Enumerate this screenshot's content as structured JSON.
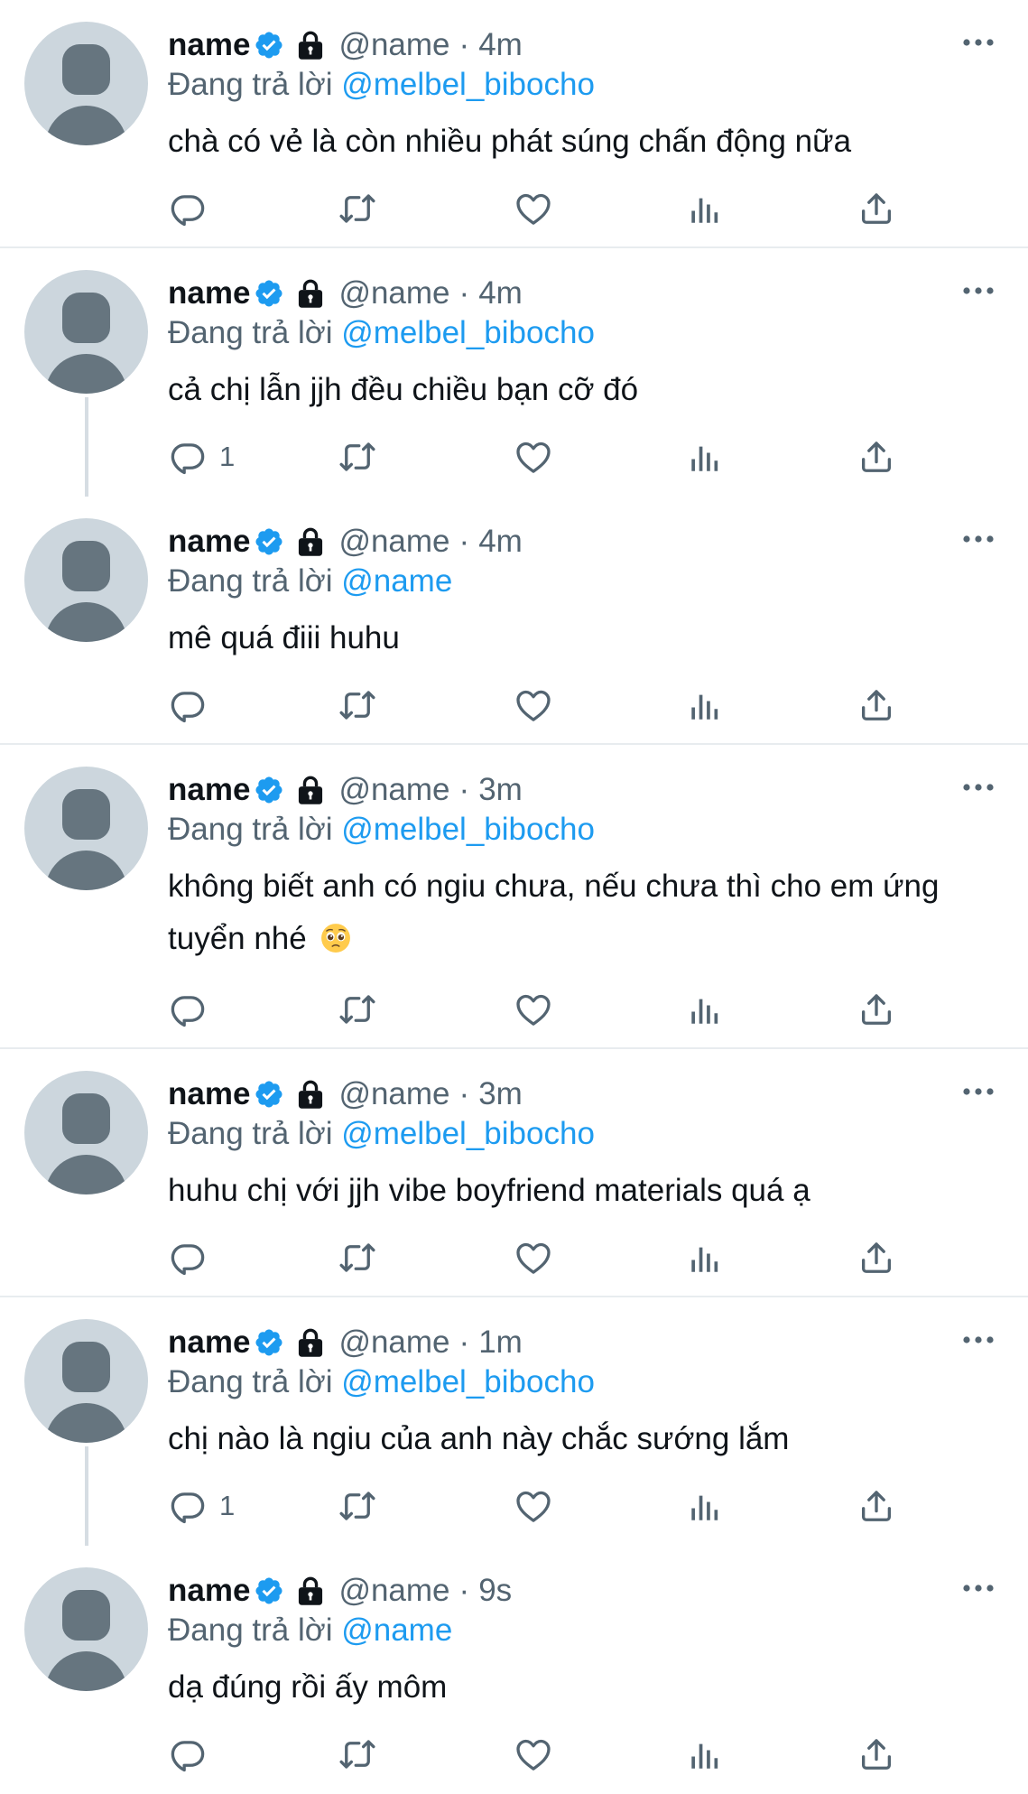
{
  "feed": {
    "tweets": [
      {
        "display_name": "name",
        "handle": "@name",
        "dot": "·",
        "time": "4m",
        "reply_prefix": "Đang trả lời",
        "reply_to": "@melbel_bibocho",
        "text": "chà có vẻ là còn nhiều phát súng chấn động nữa",
        "reply_count": "",
        "has_divider": true,
        "has_thread_line": false
      },
      {
        "display_name": "name",
        "handle": "@name",
        "dot": "·",
        "time": "4m",
        "reply_prefix": "Đang trả lời",
        "reply_to": "@melbel_bibocho",
        "text": "cả chị lẫn jjh đều chiều bạn cỡ đó",
        "reply_count": "1",
        "has_divider": false,
        "has_thread_line": true
      },
      {
        "display_name": "name",
        "handle": "@name",
        "dot": "·",
        "time": "4m",
        "reply_prefix": "Đang trả lời",
        "reply_to": "@name",
        "text": "mê quá điii huhu",
        "reply_count": "",
        "has_divider": true,
        "has_thread_line": false
      },
      {
        "display_name": "name",
        "handle": "@name",
        "dot": "·",
        "time": "3m",
        "reply_prefix": "Đang trả lời",
        "reply_to": "@melbel_bibocho",
        "text": "không biết anh có ngiu chưa, nếu chưa thì cho em ứng tuyển nhé",
        "emoji": "pleading-face-icon",
        "reply_count": "",
        "has_divider": true,
        "has_thread_line": false
      },
      {
        "display_name": "name",
        "handle": "@name",
        "dot": "·",
        "time": "3m",
        "reply_prefix": "Đang trả lời",
        "reply_to": "@melbel_bibocho",
        "text": "huhu chị với jjh vibe boyfriend materials quá ạ",
        "reply_count": "",
        "has_divider": true,
        "has_thread_line": false
      },
      {
        "display_name": "name",
        "handle": "@name",
        "dot": "·",
        "time": "1m",
        "reply_prefix": "Đang trả lời",
        "reply_to": "@melbel_bibocho",
        "text": "chị nào là ngiu của anh này chắc sướng lắm",
        "reply_count": "1",
        "has_divider": false,
        "has_thread_line": true
      },
      {
        "display_name": "name",
        "handle": "@name",
        "dot": "·",
        "time": "9s",
        "reply_prefix": "Đang trả lời",
        "reply_to": "@name",
        "text": "dạ đúng rồi ấy môm",
        "reply_count": "",
        "has_divider": false,
        "has_thread_line": false
      }
    ]
  },
  "colors": {
    "text_primary": "#0f1419",
    "text_secondary": "#536471",
    "link": "#1d9bf0",
    "verified": "#1d9bf0",
    "avatar_bg": "#ccd6dd",
    "avatar_fg": "#66757f",
    "divider": "#e8ecef",
    "thread_line": "#d6dde3"
  },
  "icons": {
    "verified": "verified-badge-icon",
    "lock": "lock-icon",
    "more": "more-horizontal-icon",
    "reply": "reply-icon",
    "retweet": "retweet-icon",
    "like": "heart-icon",
    "views": "views-icon",
    "share": "share-icon"
  }
}
